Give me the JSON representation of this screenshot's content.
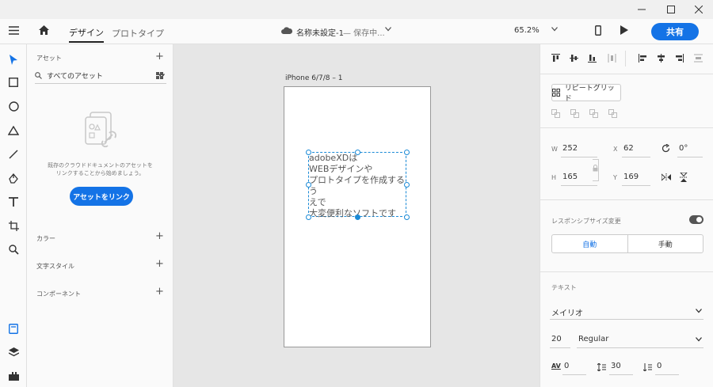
{
  "header": {
    "tab_design": "デザイン",
    "tab_prototype": "プロトタイプ",
    "doc_title": "名称未設定-1",
    "doc_status": "— 保存中...",
    "zoom": "65.2%",
    "share": "共有"
  },
  "assets": {
    "title": "アセット",
    "search_label": "すべてのアセット",
    "empty_line1": "既存のクラウドドキュメントのアセットを",
    "empty_line2": "リンクすることから始めましょう。",
    "link_button": "アセットをリンク",
    "colors": "カラー",
    "text_styles": "文字スタイル",
    "components": "コンポーネント"
  },
  "canvas": {
    "artboard_name": "iPhone 6/7/8 – 1",
    "text_lines": [
      "adobeXDは",
      "WEBデザインや",
      "プロトタイプを作成するう",
      "えで",
      "大変便利なソフトです"
    ]
  },
  "properties": {
    "repeat_grid": "リピートグリッド",
    "w_label": "W",
    "w_value": "252",
    "x_label": "X",
    "x_value": "62",
    "rot_value": "0°",
    "h_label": "H",
    "h_value": "165",
    "y_label": "Y",
    "y_value": "169",
    "responsive": "レスポンシブサイズ変更",
    "auto": "自動",
    "manual": "手動",
    "text_section": "テキスト",
    "font_family": "メイリオ",
    "font_size": "20",
    "font_weight": "Regular",
    "char_spacing": "0",
    "line_spacing": "30",
    "para_spacing": "0"
  },
  "colors": {
    "accent": "#1473e6",
    "selection": "#1b8ad6"
  }
}
